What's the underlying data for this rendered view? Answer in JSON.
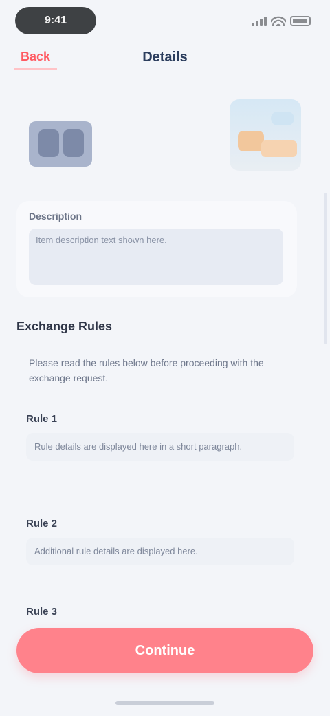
{
  "status_bar": {
    "time": "9:41",
    "signal_icon": "signal-icon",
    "wifi_icon": "wifi-icon",
    "battery_icon": "battery-icon"
  },
  "nav": {
    "back_label": "Back",
    "title": "Details"
  },
  "hero": {
    "left_image": "item-image",
    "right_image": "item-image"
  },
  "description": {
    "label": "Description",
    "text": "Item description text shown here."
  },
  "section": {
    "title": "Exchange Rules",
    "intro": "Please read the rules below before proceeding with the exchange request."
  },
  "rules": [
    {
      "title": "Rule 1",
      "body": "Rule details are displayed here in a short paragraph."
    },
    {
      "title": "Rule 2",
      "body": "Additional rule details are displayed here."
    },
    {
      "title": "Rule 3",
      "body": ""
    }
  ],
  "cta": {
    "label": "Continue"
  },
  "colors": {
    "accent": "#ff828b",
    "background": "#f3f5f9"
  }
}
